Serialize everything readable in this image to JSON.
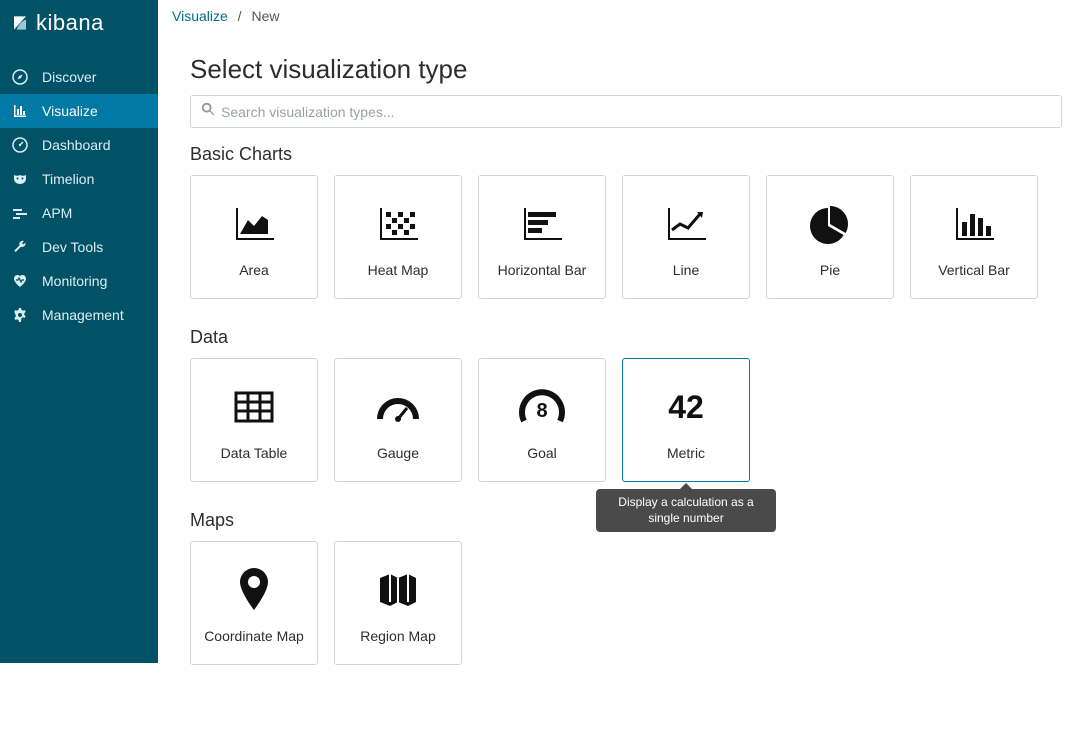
{
  "app": {
    "name": "kibana"
  },
  "sidebar": {
    "items": [
      {
        "label": "Discover",
        "icon": "compass"
      },
      {
        "label": "Visualize",
        "icon": "barchart",
        "active": true
      },
      {
        "label": "Dashboard",
        "icon": "dashboard"
      },
      {
        "label": "Timelion",
        "icon": "mask"
      },
      {
        "label": "APM",
        "icon": "apm"
      },
      {
        "label": "Dev Tools",
        "icon": "wrench"
      },
      {
        "label": "Monitoring",
        "icon": "heartbeat"
      },
      {
        "label": "Management",
        "icon": "gear"
      }
    ]
  },
  "breadcrumb": {
    "root": "Visualize",
    "current": "New"
  },
  "page": {
    "title": "Select visualization type",
    "search_placeholder": "Search visualization types..."
  },
  "sections": [
    {
      "title": "Basic Charts",
      "cards": [
        {
          "label": "Area",
          "icon": "area"
        },
        {
          "label": "Heat Map",
          "icon": "heatmap"
        },
        {
          "label": "Horizontal Bar",
          "icon": "hbar"
        },
        {
          "label": "Line",
          "icon": "line"
        },
        {
          "label": "Pie",
          "icon": "pie"
        },
        {
          "label": "Vertical Bar",
          "icon": "vbar"
        }
      ]
    },
    {
      "title": "Data",
      "cards": [
        {
          "label": "Data Table",
          "icon": "table"
        },
        {
          "label": "Gauge",
          "icon": "gauge"
        },
        {
          "label": "Goal",
          "icon": "goal",
          "text": "8"
        },
        {
          "label": "Metric",
          "icon": "metric",
          "text": "42",
          "highlight": true,
          "tooltip": "Display a calculation as a single number"
        }
      ]
    },
    {
      "title": "Maps",
      "cards": [
        {
          "label": "Coordinate Map",
          "icon": "pin"
        },
        {
          "label": "Region Map",
          "icon": "regionmap"
        }
      ]
    }
  ]
}
